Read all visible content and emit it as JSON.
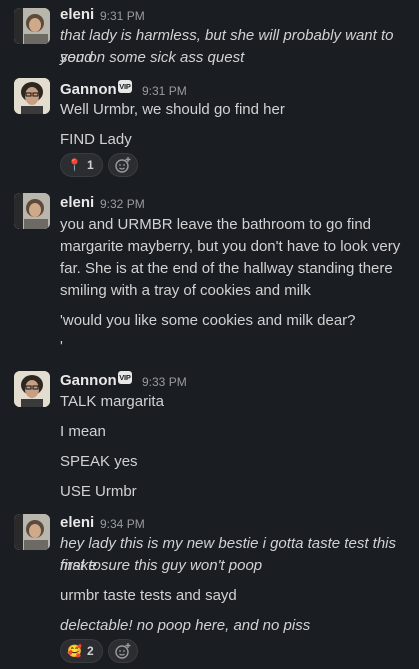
{
  "messages": [
    {
      "author": "eleni",
      "time": "9:31 PM",
      "lines": [
        "that lady is harmless, but she will probably want to send",
        "you on some sick ass quest"
      ]
    },
    {
      "author": "Gannon",
      "badge": "VIP",
      "time": "9:31 PM",
      "lines": [
        "Well Urmbr, we should go find her",
        "FIND Lady"
      ],
      "reaction": {
        "emoji": "📍",
        "count": "1"
      }
    },
    {
      "author": "eleni",
      "time": "9:32 PM",
      "lines": [
        "you and URMBR leave the bathroom to go find",
        "margarite mayberry, but you don't have to look very",
        "far. She is at the end of the hallway standing there",
        "smiling with a tray of cookies and milk",
        "'would you like some cookies and milk dear?",
        "'"
      ]
    },
    {
      "author": "Gannon",
      "badge": "VIP",
      "time": "9:33 PM",
      "lines": [
        "TALK margarita",
        "I mean",
        "SPEAK yes",
        "USE Urmbr"
      ]
    },
    {
      "author": "eleni",
      "time": "9:34 PM",
      "lines": [
        "hey lady this is my new bestie i gotta taste test this first to",
        "make sure this guy won't poop",
        "urmbr taste tests and sayd",
        "delectable! no poop here, and no piss"
      ],
      "reaction": {
        "emoji": "🥰",
        "count": "2"
      }
    }
  ],
  "icons": {
    "add_reaction": "add-reaction-icon"
  },
  "colors": {
    "background": "#1a1d21",
    "text": "#d1d2d3",
    "timestamp": "#9a9b9e"
  }
}
